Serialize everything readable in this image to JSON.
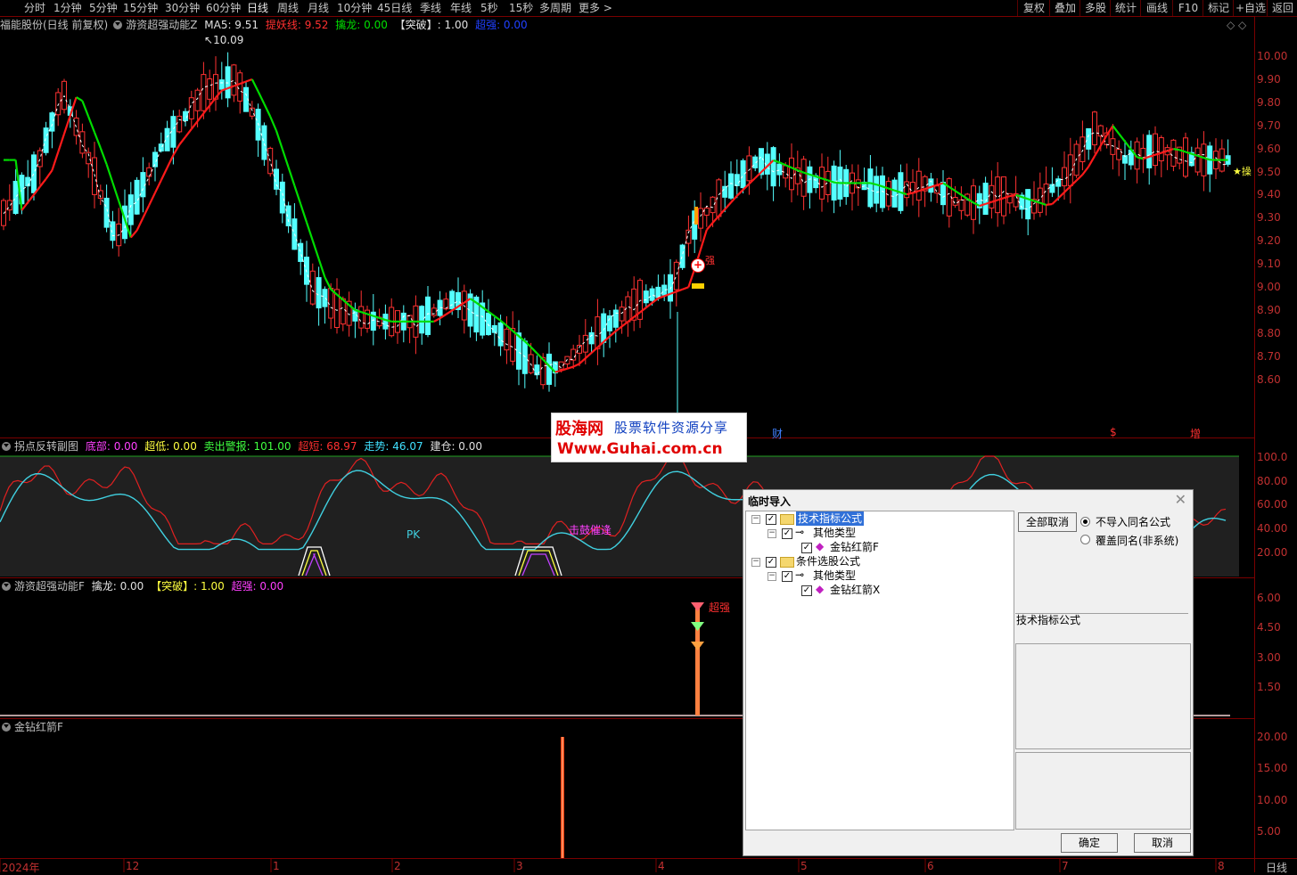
{
  "toolbar": {
    "periods": [
      "分时",
      "1分钟",
      "5分钟",
      "15分钟",
      "30分钟",
      "60分钟",
      "日线",
      "周线",
      "月线",
      "10分钟",
      "45日线",
      "季线",
      "年线",
      "5秒",
      "15秒",
      "多周期",
      "更多 >"
    ],
    "active_period": "日线",
    "right_buttons": [
      "复权",
      "叠加",
      "多股",
      "统计",
      "画线",
      "F10",
      "标记",
      "+自选",
      "返回"
    ]
  },
  "main_panel": {
    "stock": "福能股份(日线 前复权)",
    "indicator": "游资超强动能Z",
    "ma5_label": "MA5: 9.51",
    "tiyao_label": "提妖线: 9.52",
    "qinlong_label": "擒龙: 0.00",
    "tupo_label": "【突破】: 1.00",
    "chaoqiang_label": "超强: 0.00",
    "high_marker": "10.09",
    "side_tag": "★操",
    "y_ticks": [
      "10.00",
      "9.90",
      "9.80",
      "9.70",
      "9.60",
      "9.50",
      "9.40",
      "9.30",
      "9.20",
      "9.10",
      "9.00",
      "8.90",
      "8.80",
      "8.70",
      "8.60"
    ],
    "markers": {
      "cai": "财",
      "dollar": "$",
      "zeng": "增",
      "qiang": "强"
    }
  },
  "watermark": {
    "brand": "股海网",
    "slogan": "股票软件资源分享",
    "url": "Www.Guhai.com.cn"
  },
  "sub1": {
    "name": "拐点反转副图",
    "dibu": "底部: 0.00",
    "chaodi": "超低: 0.00",
    "maichu": "卖出警报: 101.00",
    "chaoduan": "超短: 68.97",
    "zoushi": "走势: 46.07",
    "jiancang": "建仓: 0.00",
    "pk_label": "PK",
    "annotation": "击鼓催逢",
    "y_ticks": [
      "100.0",
      "80.00",
      "60.00",
      "40.00",
      "20.00"
    ]
  },
  "sub2": {
    "name": "游资超强动能F",
    "qinlong": "擒龙: 0.00",
    "tupo": "【突破】: 1.00",
    "chaoqiang": "超强: 0.00",
    "signal_label": "超强",
    "y_ticks": [
      "6.00",
      "4.50",
      "3.00",
      "1.50"
    ]
  },
  "sub3": {
    "name": "金钻红箭F",
    "y_ticks": [
      "20.00",
      "15.00",
      "10.00",
      "5.00"
    ]
  },
  "x_axis": {
    "labels": [
      "2024年",
      "12",
      "1",
      "2",
      "3",
      "4",
      "5",
      "6",
      "7",
      "8"
    ],
    "period_label": "日线"
  },
  "dialog": {
    "title": "临时导入",
    "tree": {
      "root1": "技术指标公式",
      "root1_child": "其他类型",
      "root1_leaf": "金钻红箭F",
      "root2": "条件选股公式",
      "root2_child": "其他类型",
      "root2_leaf": "金钻红箭X"
    },
    "deselect_all": "全部取消",
    "option1": "不导入同名公式",
    "option2": "覆盖同名(非系统)",
    "section_label": "技术指标公式",
    "ok": "确定",
    "cancel": "取消"
  },
  "colors": {
    "up": "#ff3232",
    "down": "#54ffff",
    "ma_green": "#00dd00",
    "ma_red": "#ff1a1a",
    "border": "#7a0000"
  }
}
